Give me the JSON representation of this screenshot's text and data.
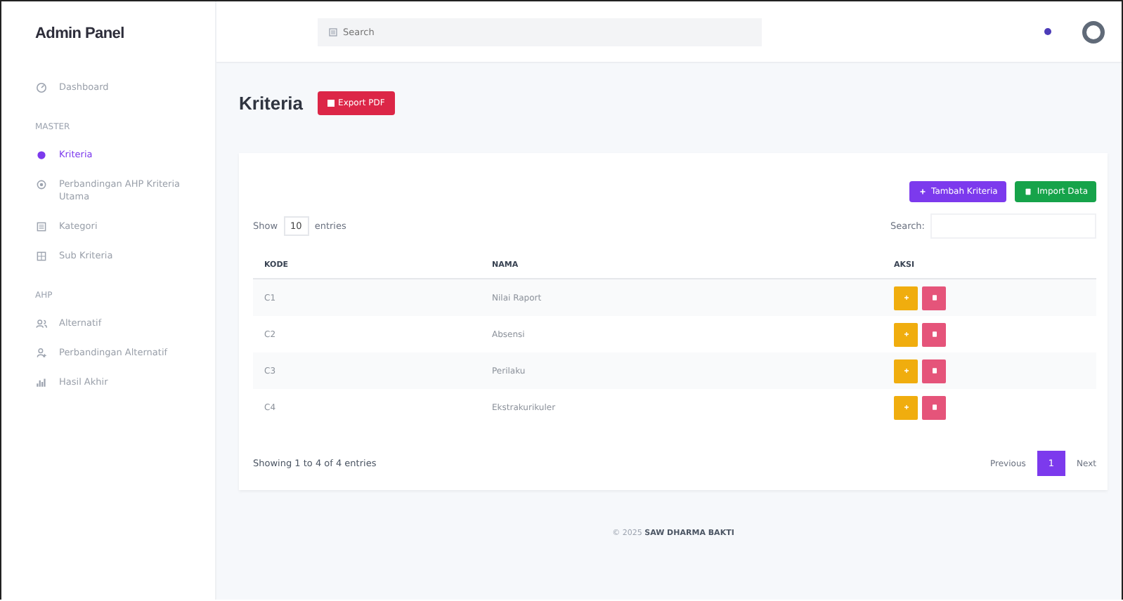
{
  "brand": "Admin Panel",
  "search": {
    "placeholder": "Search"
  },
  "sidebar": [
    {
      "kind": "item",
      "label": "Dashboard",
      "selected": false
    },
    {
      "kind": "heading",
      "label": "MASTER"
    },
    {
      "kind": "item",
      "label": "Kriteria",
      "selected": true
    },
    {
      "kind": "item",
      "label": "Perbandingan AHP Kriteria Utama",
      "selected": false
    },
    {
      "kind": "item",
      "label": "Kategori",
      "selected": false
    },
    {
      "kind": "item",
      "label": "Sub Kriteria",
      "selected": false
    },
    {
      "kind": "heading",
      "label": "AHP"
    },
    {
      "kind": "item",
      "label": "Alternatif",
      "selected": false
    },
    {
      "kind": "item",
      "label": "Perbandingan Alternatif",
      "selected": false
    },
    {
      "kind": "item",
      "label": "Hasil Akhir",
      "selected": false
    }
  ],
  "page_title": "Kriteria",
  "export_button": "Export PDF",
  "actions": [
    {
      "label": "Tambah Kriteria"
    },
    {
      "label": "Import Data"
    }
  ],
  "length": {
    "before": "Show",
    "value": "10",
    "after": "entries"
  },
  "table_search": {
    "label": "Search:"
  },
  "table": {
    "columns": [
      "KODE",
      "NAMA",
      "AKSI"
    ],
    "rows": [
      {
        "cells": [
          "C1",
          "Nilai Raport"
        ]
      },
      {
        "cells": [
          "C2",
          "Absensi"
        ]
      },
      {
        "cells": [
          "C3",
          "Perilaku"
        ]
      },
      {
        "cells": [
          "C4",
          "Ekstrakurikuler"
        ]
      }
    ]
  },
  "info": "Showing 1 to 4 of 4 entries",
  "pagination": {
    "previous": "Previous",
    "pages": [
      {
        "label": "1",
        "selected": true
      }
    ],
    "next": "Next"
  },
  "footer": "© 2025 **SAW DHARMA BAKTI**"
}
